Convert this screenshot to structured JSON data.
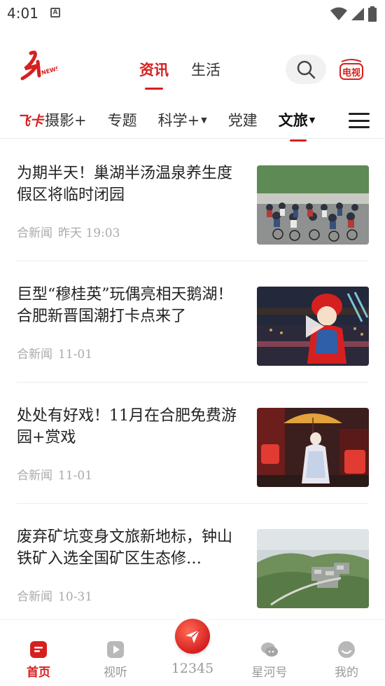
{
  "status_bar": {
    "time": "4:01",
    "notification": "A"
  },
  "header": {
    "logo": "hefei-news-logo",
    "tabs": [
      {
        "label": "资讯",
        "active": true
      },
      {
        "label": "生活",
        "active": false
      }
    ],
    "search_icon": "search-icon",
    "tv_label": "电视"
  },
  "channels": {
    "items": [
      {
        "badge": "飞卡",
        "label": "摄影+",
        "active": false,
        "dropdown": false
      },
      {
        "label": "专题",
        "active": false,
        "dropdown": false
      },
      {
        "label": "科学+",
        "active": false,
        "dropdown": true
      },
      {
        "label": "党建",
        "active": false,
        "dropdown": false
      },
      {
        "label": "文旅",
        "active": true,
        "dropdown": true
      }
    ]
  },
  "news": [
    {
      "title": "为期半天！巢湖半汤温泉养生度假区将临时闭园",
      "source": "合新闻",
      "time": "昨天 19:03",
      "thumb": "cyclists-race-photo",
      "video": false
    },
    {
      "title": "巨型“穆桂英”玩偶亮相天鹅湖！合肥新晋国潮打卡点来了",
      "source": "合新闻",
      "time": "11-01",
      "thumb": "opera-doll-night-photo",
      "video": true
    },
    {
      "title": "处处有好戏！11月在合肥免费游园+赏戏",
      "source": "合新闻",
      "time": "11-01",
      "thumb": "opera-performer-umbrella-photo",
      "video": false
    },
    {
      "title": "废弃矿坑变身文旅新地标，钟山铁矿入选全国矿区生态修…",
      "source": "合新闻",
      "time": "10-31",
      "thumb": "mountain-mine-aerial-photo",
      "video": false
    }
  ],
  "bottom_nav": {
    "items": [
      {
        "label": "首页",
        "icon": "home-icon",
        "active": true
      },
      {
        "label": "视听",
        "icon": "play-icon",
        "active": false
      },
      {
        "label": "12345",
        "icon": "hotline-icon",
        "active": false
      },
      {
        "label": "星河号",
        "icon": "chat-icon",
        "active": false
      },
      {
        "label": "我的",
        "icon": "profile-icon",
        "active": false
      }
    ]
  },
  "colors": {
    "accent": "#d6201f",
    "muted": "#999999",
    "divider": "#ececec"
  }
}
